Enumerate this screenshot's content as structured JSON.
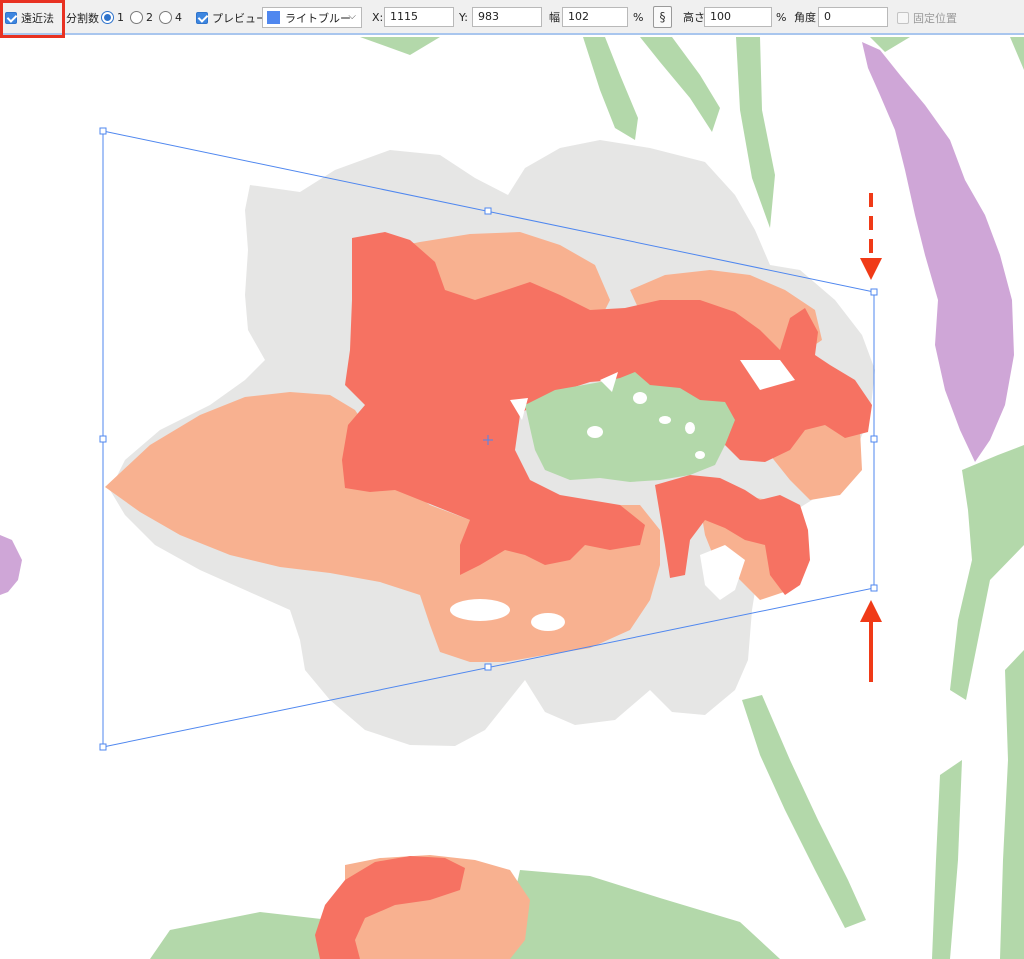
{
  "toolbar": {
    "perspective_label": "遠近法",
    "divisions_label": "分割数",
    "divisions_options": [
      "1",
      "2",
      "4"
    ],
    "divisions_selected": "1",
    "preview_label": "プレビュー",
    "color_value": "ライトブルー",
    "color_swatch": "#4f87ef",
    "x_label": "X:",
    "x_value": "1115",
    "y_label": "Y:",
    "y_value": "983",
    "width_label": "幅",
    "width_value": "102",
    "height_label": "高さ",
    "height_value": "100",
    "percent": "%",
    "angle_label": "角度",
    "angle_value": "0",
    "fixed_position_label": "固定位置",
    "link_icon": "chain-link-icon",
    "chevron_icon": "chevron-down-icon"
  },
  "colors": {
    "accent": "#e83222",
    "selection_line": "#4f87ef",
    "petal_red": "#f67262",
    "petal_peach": "#f8b190",
    "leaf_green": "#b3d8aa",
    "shadow_gray": "#e6e6e5",
    "lavender": "#cfa6d7"
  }
}
